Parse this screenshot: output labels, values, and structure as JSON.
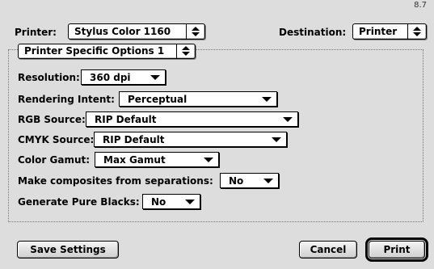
{
  "version": "8.7",
  "printer": {
    "label": "Printer:",
    "value": "Stylus Color 1160"
  },
  "destination": {
    "label": "Destination:",
    "value": "Printer"
  },
  "panel": {
    "value": "Printer Specific Options 1"
  },
  "options": {
    "resolution": {
      "label": "Resolution:",
      "value": "360 dpi"
    },
    "rendering_intent": {
      "label": "Rendering Intent:",
      "value": "Perceptual"
    },
    "rgb_source": {
      "label": "RGB Source:",
      "value": "RIP Default"
    },
    "cmyk_source": {
      "label": "CMYK Source:",
      "value": "RIP Default"
    },
    "color_gamut": {
      "label": "Color Gamut:",
      "value": "Max Gamut"
    },
    "composites": {
      "label": "Make composites from separations:",
      "value": "No"
    },
    "pure_blacks": {
      "label": "Generate Pure Blacks:",
      "value": "No"
    }
  },
  "buttons": {
    "save_settings": "Save Settings",
    "cancel": "Cancel",
    "print": "Print"
  }
}
